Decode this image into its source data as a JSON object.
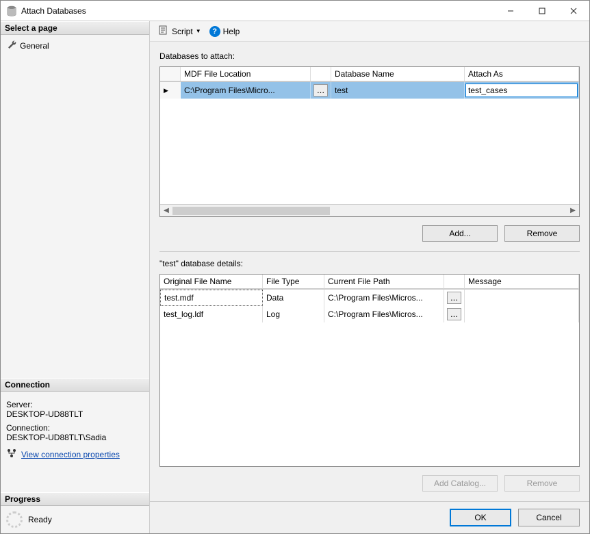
{
  "window": {
    "title": "Attach Databases"
  },
  "sidebar": {
    "select_page_header": "Select a page",
    "page_general": "General",
    "connection_header": "Connection",
    "server_label": "Server:",
    "server_value": "DESKTOP-UD88TLT",
    "connection_label": "Connection:",
    "connection_value": "DESKTOP-UD88TLT\\Sadia",
    "view_props": "View connection properties",
    "progress_header": "Progress",
    "progress_status": "Ready"
  },
  "toolbar": {
    "script_label": "Script",
    "help_label": "Help"
  },
  "attach": {
    "label": "Databases to attach:",
    "columns": {
      "mdf": "MDF File Location",
      "dbname": "Database Name",
      "attachas": "Attach As"
    },
    "row": {
      "mdf_path": "C:\\Program Files\\Micro...",
      "dbname": "test",
      "attach_as_value": "test_cases"
    },
    "add_btn": "Add...",
    "remove_btn": "Remove"
  },
  "details": {
    "label": "\"test\" database details:",
    "columns": {
      "orig": "Original File Name",
      "type": "File Type",
      "path": "Current File Path",
      "msg": "Message"
    },
    "rows": [
      {
        "name": "test.mdf",
        "type": "Data",
        "path": "C:\\Program Files\\Micros..."
      },
      {
        "name": "test_log.ldf",
        "type": "Log",
        "path": "C:\\Program Files\\Micros..."
      }
    ],
    "add_catalog_btn": "Add Catalog...",
    "remove_btn": "Remove"
  },
  "footer": {
    "ok": "OK",
    "cancel": "Cancel"
  },
  "ellipsis": "..."
}
